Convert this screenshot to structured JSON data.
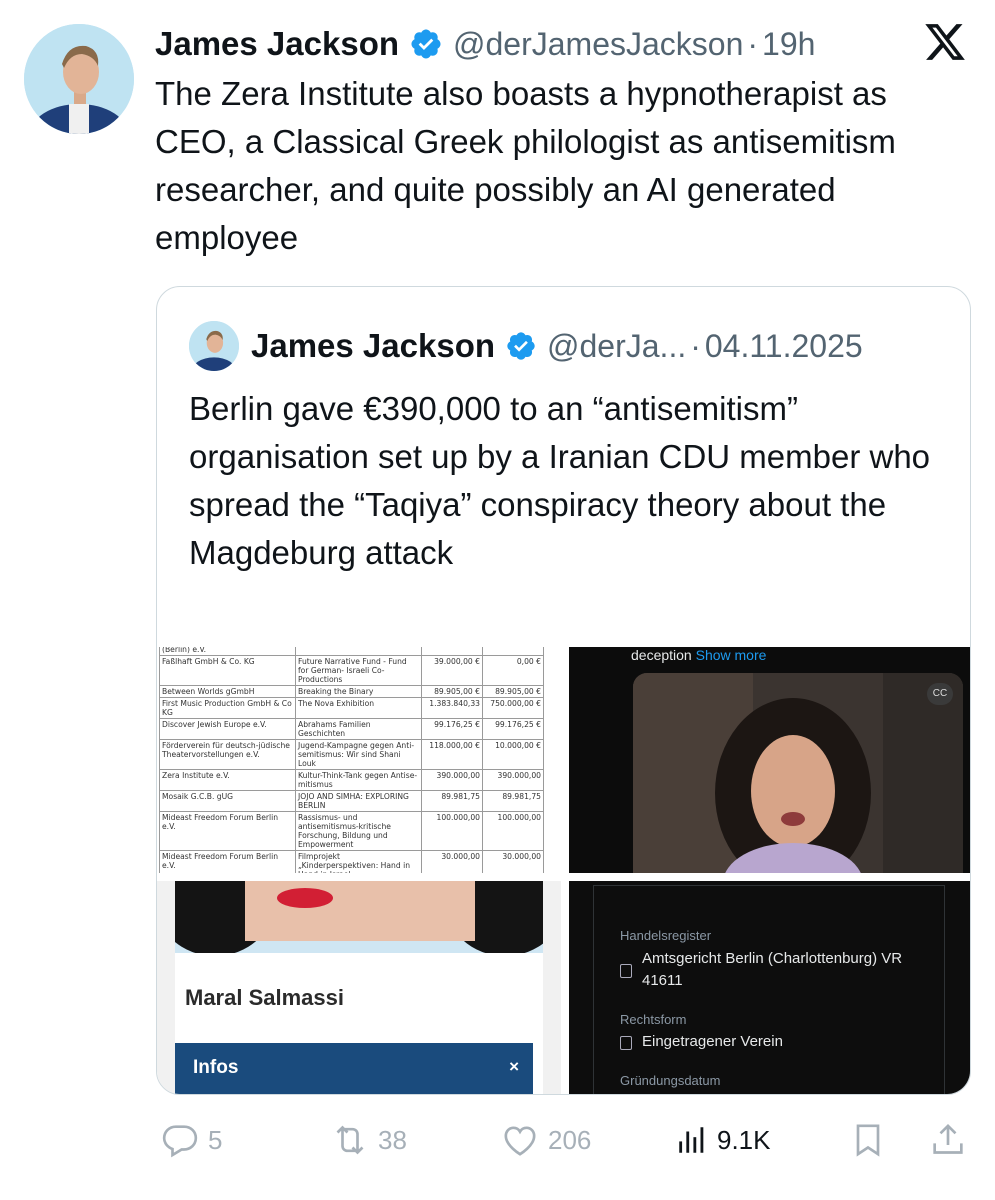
{
  "tweet": {
    "author_name": "James Jackson",
    "handle": "@derJamesJackson",
    "separator": "·",
    "time": "19h",
    "text": "The Zera Institute also boasts a hypnotherapist as CEO, a Classical Greek philologist as antisemitism researcher, and quite possibly an AI generated employee",
    "icons": {
      "verified": "verified-badge-icon",
      "platform": "x-logo-icon"
    },
    "accent_color": "#1d9bf0"
  },
  "quote": {
    "author_name": "James Jackson",
    "handle": "@derJa...",
    "separator": "·",
    "date": "04.11.2025",
    "text": "Berlin gave €390,000 to an “antisemitism” organisation set up by a Iranian CDU member who spread the “Taqiya” conspiracy theory about the Magdeburg attack"
  },
  "media": {
    "funding_table": {
      "rows": [
        [
          "(Berlin) e.V.",
          "",
          "",
          ""
        ],
        [
          "Faßlhaft GmbH & Co. KG",
          "Future Narrative Fund - Fund for German- Israeli Co-Productions",
          "39.000,00 €",
          "0,00 €"
        ],
        [
          "Between Worlds gGmbH",
          "Breaking the Binary",
          "89.905,00 €",
          "89.905,00 €"
        ],
        [
          "First Music Production GmbH & Co KG",
          "The Nova Exhibition",
          "1.383.840,33",
          "750.000,00 €"
        ],
        [
          "Discover Jewish Europe e.V.",
          "Abrahams Familien Geschichten",
          "99.176,25 €",
          "99.176,25 €"
        ],
        [
          "Förderverein für deutsch-jüdische Theatervorstellungen e.V.",
          "Jugend-Kampagne gegen Anti-semitismus: Wir sind Shani Louk",
          "118.000,00 €",
          "10.000,00 €"
        ],
        [
          "Zera Institute e.V.",
          "Kultur-Think-Tank gegen Antise-mitismus",
          "390.000,00",
          "390.000,00"
        ],
        [
          "Mosaik G.C.B. gUG",
          "JOJO AND SIMHA: EXPLORING BERLIN",
          "89.981,75",
          "89.981,75"
        ],
        [
          "Mideast Freedom Forum Berlin e.V.",
          "Rassismus- und antisemitismus-kritische Forschung, Bildung und Empowerment",
          "100.000,00",
          "100.000,00"
        ],
        [
          "Mideast Freedom Forum Berlin e.V.",
          "Filmprojekt „Kinderperspektiven: Hand in Hand in Israel",
          "30.000,00",
          "30.000,00"
        ]
      ]
    },
    "video": {
      "caption_text": "deception",
      "show_more_label": "Show more",
      "cc_label": "CC"
    },
    "profile": {
      "name": "Maral Salmassi",
      "infos_label": "Infos",
      "close_label": "×"
    },
    "registry": {
      "handelsregister_label": "Handelsregister",
      "handelsregister_value": "Amtsgericht Berlin (Charlottenburg) VR 41611",
      "rechtsform_label": "Rechtsform",
      "rechtsform_value": "Eingetragener Verein",
      "gruendung_label": "Gründungsdatum"
    }
  },
  "actions": {
    "replies": "5",
    "reposts": "38",
    "likes": "206",
    "views": "9.1K"
  }
}
